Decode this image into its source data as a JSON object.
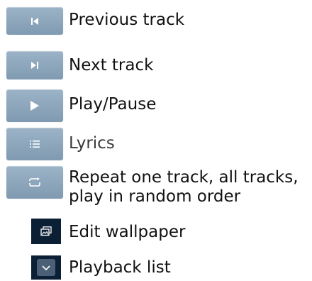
{
  "legend": {
    "items": [
      {
        "id": "previous",
        "icon": "previous-track-icon",
        "label": "Previous track"
      },
      {
        "id": "next",
        "icon": "next-track-icon",
        "label": "Next track"
      },
      {
        "id": "play",
        "icon": "play-icon",
        "label": "Play/Pause"
      },
      {
        "id": "lyrics",
        "icon": "lyrics-icon",
        "label": "Lyrics"
      },
      {
        "id": "repeat",
        "icon": "repeat-icon",
        "label_line1": "Repeat one track, all tracks,",
        "label_line2": "play in random order"
      },
      {
        "id": "wallpaper",
        "icon": "wallpaper-icon",
        "label": "Edit wallpaper"
      },
      {
        "id": "playback",
        "icon": "chevron-down-icon",
        "label": "Playback list"
      }
    ]
  },
  "colors": {
    "button_light": "#8fa8bd",
    "button_dark": "#0b1f35",
    "icon_white": "#ffffff",
    "text": "#111111"
  }
}
